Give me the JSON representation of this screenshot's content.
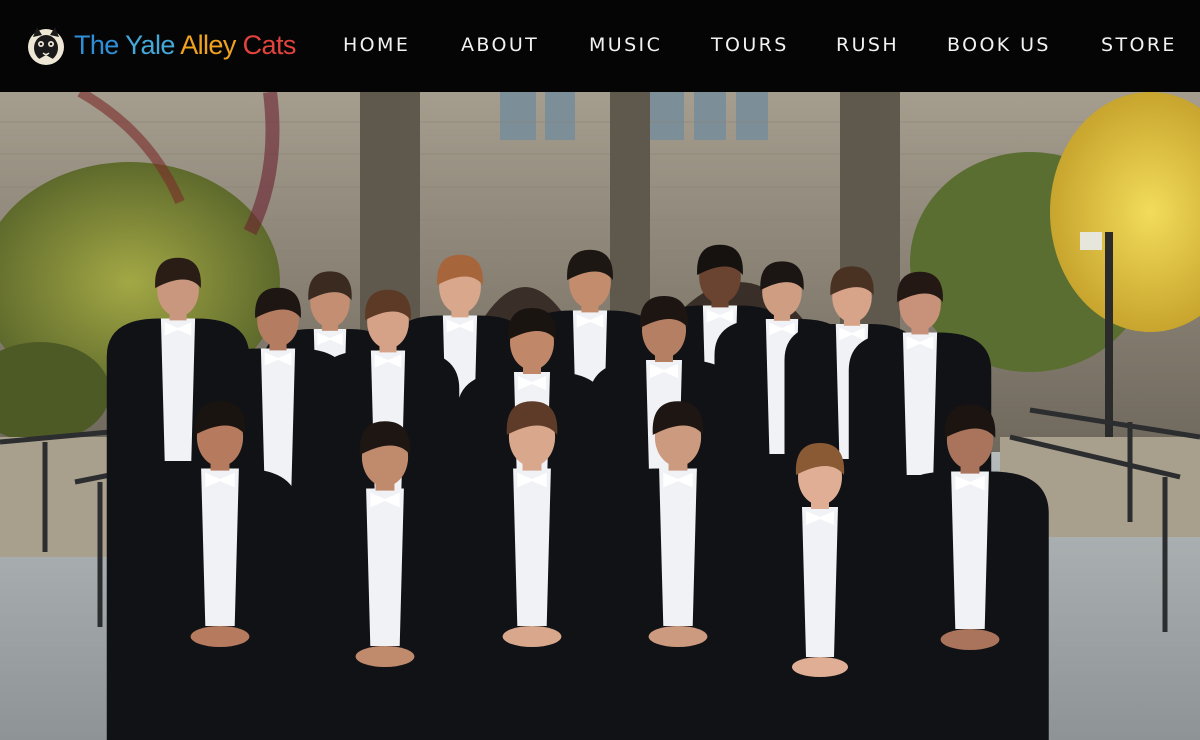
{
  "site": {
    "logo_words": [
      {
        "text": "The ",
        "color": "#2f8fd6"
      },
      {
        "text": "Yale ",
        "color": "#45a6d8"
      },
      {
        "text": "Alley ",
        "color": "#f0a21f"
      },
      {
        "text": "Cats",
        "color": "#e2433c"
      }
    ],
    "logo_icon": "cat-mascot-icon"
  },
  "nav": {
    "items": [
      {
        "label": "HOME"
      },
      {
        "label": "ABOUT"
      },
      {
        "label": "MUSIC"
      },
      {
        "label": "TOURS"
      },
      {
        "label": "RUSH"
      },
      {
        "label": "BOOK US"
      },
      {
        "label": "STORE"
      }
    ]
  },
  "hero": {
    "description_icon": "group-photo",
    "palette": {
      "stone": "#8f8676",
      "stone_dark": "#5d574d",
      "foliage": "#8d9a3a",
      "foliage_yellow": "#e9d24a",
      "tux": "#111216",
      "shirt": "#f1f2f5",
      "skin": "#c8957a",
      "pavement": "#9fa4a6"
    }
  }
}
